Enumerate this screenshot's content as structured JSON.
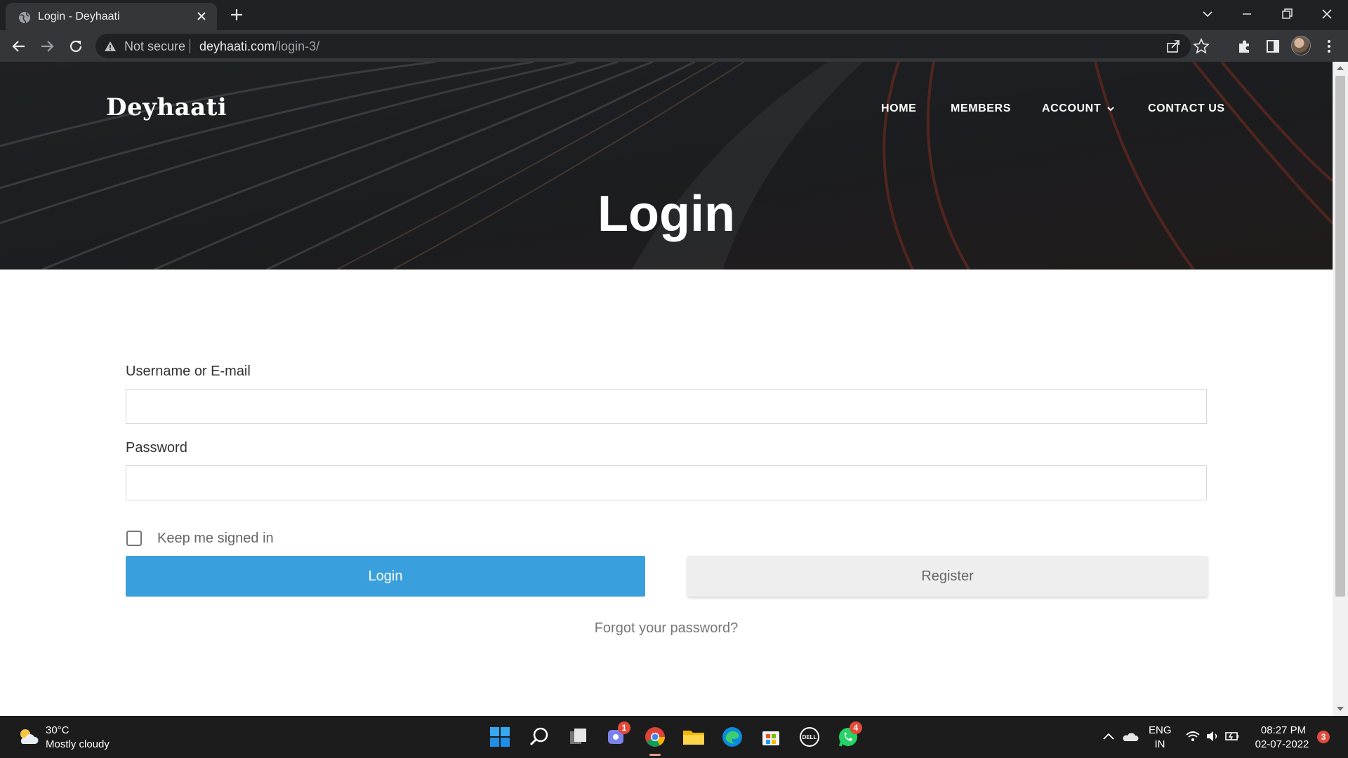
{
  "browser": {
    "tab_title": "Login - Deyhaati",
    "security_label": "Not secure",
    "url_domain": "deyhaati.com",
    "url_path": "/login-3/"
  },
  "site": {
    "brand": "Deyhaati",
    "nav": {
      "home": "HOME",
      "members": "MEMBERS",
      "account": "ACCOUNT",
      "contact": "CONTACT US"
    },
    "hero_title": "Login"
  },
  "form": {
    "username_label": "Username or E-mail",
    "username_value": "",
    "password_label": "Password",
    "password_value": "",
    "remember_label": "Keep me signed in",
    "remember_checked": false,
    "login_button": "Login",
    "register_button": "Register",
    "forgot_link": "Forgot your password?"
  },
  "taskbar": {
    "weather_temp": "30°C",
    "weather_desc": "Mostly cloudy",
    "teams_badge": "1",
    "whatsapp_badge": "4",
    "language_top": "ENG",
    "language_bottom": "IN",
    "time": "08:27 PM",
    "date": "02-07-2022",
    "notification_count": "3"
  },
  "icons": [
    "globe-icon",
    "close-icon",
    "plus-icon",
    "chevron-down-icon",
    "minimize-icon",
    "restore-icon",
    "back-icon",
    "forward-icon",
    "reload-icon",
    "warning-icon",
    "share-icon",
    "star-icon",
    "puzzle-icon",
    "side-panel-icon",
    "menu-icon",
    "weather-icon",
    "windows-start-icon",
    "search-icon",
    "task-view-icon",
    "teams-icon",
    "chrome-icon",
    "file-explorer-icon",
    "edge-icon",
    "store-icon",
    "dell-icon",
    "whatsapp-icon",
    "onedrive-icon",
    "wifi-icon",
    "volume-icon",
    "battery-icon"
  ],
  "colors": {
    "login_button": "#3aa0dd",
    "register_button": "#eeeeee",
    "chrome_dark": "#202124"
  }
}
